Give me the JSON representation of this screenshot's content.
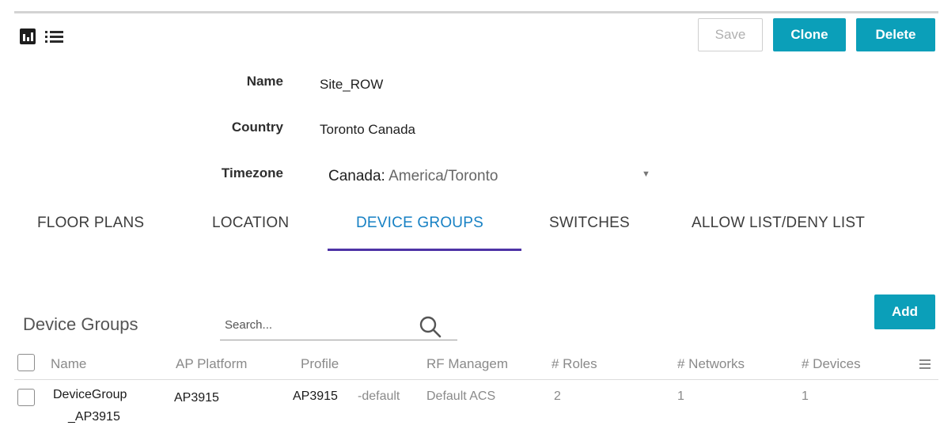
{
  "toolbar": {
    "chart_view_icon": "bar-chart-icon",
    "list_view_icon": "list-icon",
    "save_label": "Save",
    "clone_label": "Clone",
    "delete_label": "Delete"
  },
  "form": {
    "name_label": "Name",
    "name_value": "Site_ROW",
    "country_label": "Country",
    "country_value": "Toronto Canada",
    "timezone_label": "Timezone",
    "timezone_region": "Canada:",
    "timezone_value": "America/Toronto"
  },
  "tabs": [
    {
      "label": "FLOOR PLANS"
    },
    {
      "label": "LOCATION"
    },
    {
      "label": "DEVICE GROUPS",
      "active": true
    },
    {
      "label": "SWITCHES"
    },
    {
      "label": "ALLOW LIST/DENY LIST"
    }
  ],
  "device_groups": {
    "title": "Device Groups",
    "search_placeholder": "Search...",
    "add_label": "Add",
    "columns": [
      "Name",
      "AP Platform",
      "Profile",
      "RF Managem",
      "# Roles",
      "# Networks",
      "# Devices"
    ],
    "rows": [
      {
        "name_line1": "DeviceGroup",
        "name_line2": "_AP3915",
        "ap_platform": "AP3915",
        "profile": "AP3915",
        "profile_suffix": "-default",
        "rf_management": "Default ACS",
        "roles": "2",
        "networks": "1",
        "devices": "1"
      }
    ]
  },
  "colors": {
    "accent": "#0b9fb9",
    "active_tab": "#1781c4",
    "tab_underline": "#4e33a6"
  }
}
